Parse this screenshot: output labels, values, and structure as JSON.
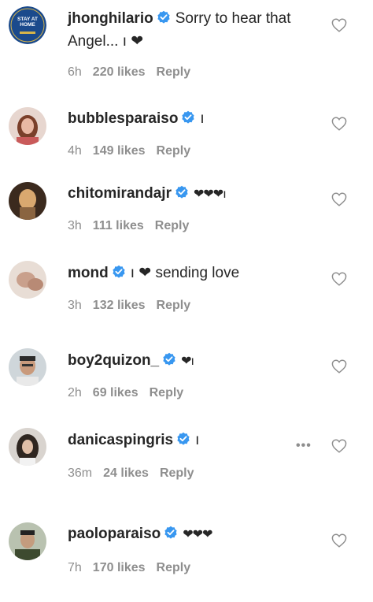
{
  "comments": [
    {
      "username": "jhonghilario",
      "text": "Sorry to hear that Angel... ı ❤",
      "time": "6h",
      "likes": "220 likes",
      "reply": "Reply",
      "avatar_text": "STAY AT HOME",
      "avatar_color": "#1b4a8c"
    },
    {
      "username": "bubblesparaiso",
      "text": "ı",
      "time": "4h",
      "likes": "149 likes",
      "reply": "Reply",
      "avatar_color": "#c58b7e"
    },
    {
      "username": "chitomirandajr",
      "text": "❤❤❤ı",
      "time": "3h",
      "likes": "111 likes",
      "reply": "Reply",
      "avatar_color": "#7a5a3a"
    },
    {
      "username": "mond",
      "text": "ı ❤ sending love",
      "time": "3h",
      "likes": "132 likes",
      "reply": "Reply",
      "avatar_color": "#bfa79a"
    },
    {
      "username": "boy2quizon_",
      "text": "❤ı",
      "time": "2h",
      "likes": "69 likes",
      "reply": "Reply",
      "avatar_color": "#9aa3a8"
    },
    {
      "username": "danicaspingris",
      "text": "ı",
      "time": "36m",
      "likes": "24 likes",
      "reply": "Reply",
      "more": "•••",
      "avatar_color": "#6b6b6b"
    },
    {
      "username": "paoloparaiso",
      "text": "❤❤❤",
      "time": "7h",
      "likes": "170 likes",
      "reply": "Reply",
      "avatar_color": "#4e5a3e"
    }
  ],
  "colors": {
    "verified_blue": "#3897f0",
    "text": "#262626",
    "muted": "#8e8e8e"
  },
  "icons": {
    "verified": "verified-badge-icon",
    "like": "heart-outline-icon",
    "more": "more-options-icon"
  }
}
